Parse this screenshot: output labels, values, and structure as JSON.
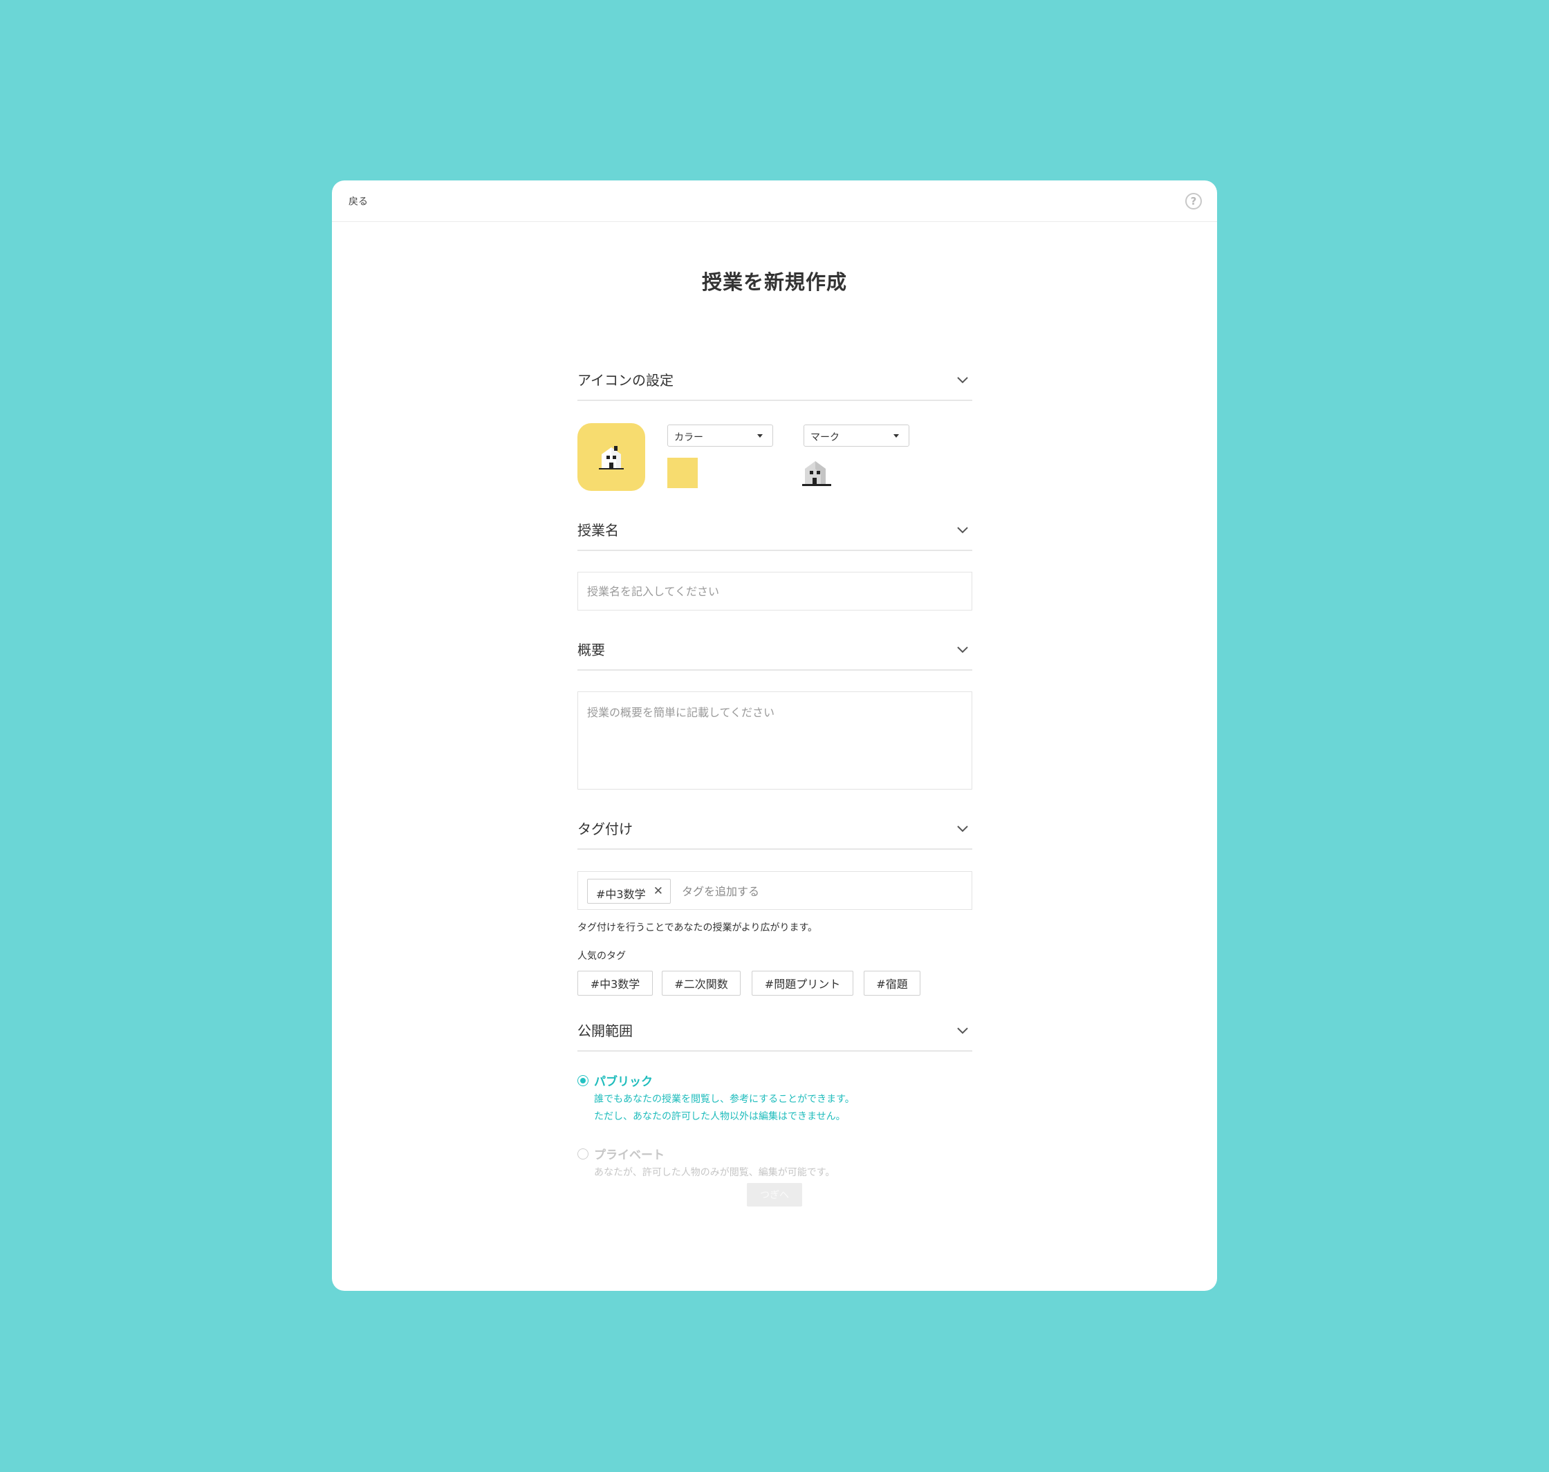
{
  "header": {
    "back_label": "戻る",
    "help_label": "?"
  },
  "page_title": "授業を新規作成",
  "icon_section": {
    "title": "アイコンの設定",
    "color_select": "カラー",
    "mark_select": "マーク",
    "selected_color": "#f7dc6f"
  },
  "name_section": {
    "title": "授業名",
    "placeholder": "授業名を記入してください"
  },
  "summary_section": {
    "title": "概要",
    "placeholder": "授業の概要を簡単に記載してください"
  },
  "tag_section": {
    "title": "タグ付け",
    "current_tags": [
      "#中3数学"
    ],
    "add_placeholder": "タグを追加する",
    "note": "タグ付けを行うことであなたの授業がより広がります。",
    "popular_label": "人気のタグ",
    "popular_tags": [
      "#中3数学",
      "#二次関数",
      "#問題プリント",
      "#宿題"
    ]
  },
  "visibility_section": {
    "title": "公開範囲",
    "options": [
      {
        "label": "パブリック",
        "desc1": "誰でもあなたの授業を閲覧し、参考にすることができます。",
        "desc2": "ただし、あなたの許可した人物以外は編集はできません。",
        "selected": true
      },
      {
        "label": "プライベート",
        "desc1": "あなたが、許可した人物のみが閲覧、編集が可能です。",
        "selected": false
      }
    ]
  },
  "next_button": "つぎへ",
  "colors": {
    "background": "#6bd6d6",
    "accent": "#23c2c2",
    "icon_yellow": "#f7dc6f"
  }
}
